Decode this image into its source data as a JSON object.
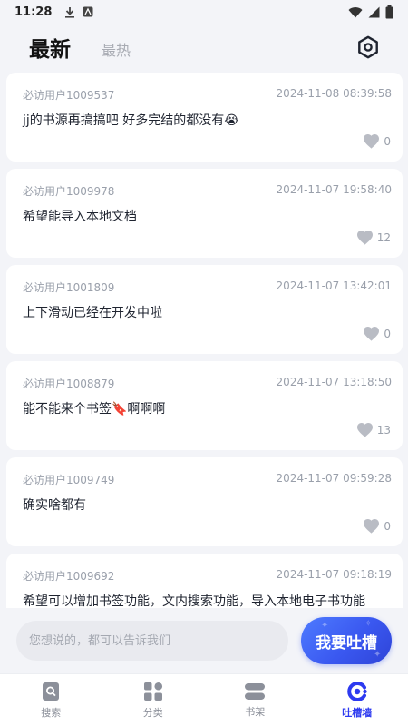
{
  "status_bar": {
    "time": "11:28"
  },
  "header": {
    "tab_latest": "最新",
    "tab_hot": "最热"
  },
  "posts": [
    {
      "user": "必访用户1009537",
      "date": "2024-11-08 08:39:58",
      "content": "jj的书源再搞搞吧 好多完结的都没有😭",
      "likes": "0"
    },
    {
      "user": "必访用户1009978",
      "date": "2024-11-07 19:58:40",
      "content": "希望能导入本地文档",
      "likes": "12"
    },
    {
      "user": "必访用户1001809",
      "date": "2024-11-07 13:42:01",
      "content": "上下滑动已经在开发中啦",
      "likes": "0"
    },
    {
      "user": "必访用户1008879",
      "date": "2024-11-07 13:18:50",
      "content": "能不能来个书签🔖啊啊啊",
      "likes": "13"
    },
    {
      "user": "必访用户1009749",
      "date": "2024-11-07 09:59:28",
      "content": "确实啥都有",
      "likes": "0"
    },
    {
      "user": "必访用户1009692",
      "date": "2024-11-07 09:18:19",
      "content": "希望可以增加书签功能，文内搜索功能，导入本地电子书功能",
      "likes": ""
    }
  ],
  "composer": {
    "placeholder": "您想说的，都可以告诉我们",
    "submit_label": "我要吐槽"
  },
  "bottom_nav": {
    "search": "搜索",
    "category": "分类",
    "bookshelf": "书架",
    "feedback": "吐槽墙"
  },
  "colors": {
    "accent": "#2d3af0",
    "button_gradient_start": "#4e7bff",
    "button_gradient_end": "#2f44d8",
    "background": "#f3f4f8",
    "muted_text": "#9aa0ab"
  }
}
